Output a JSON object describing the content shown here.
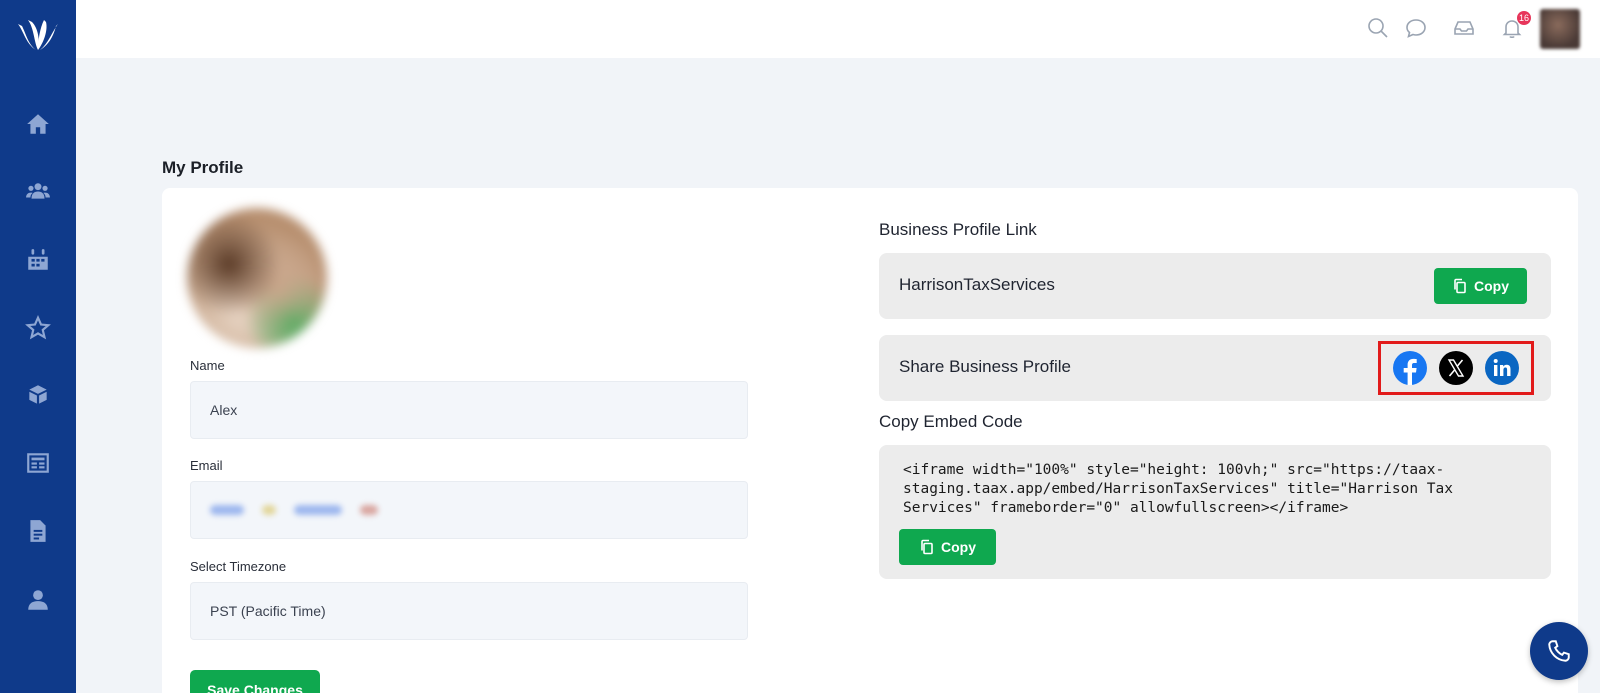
{
  "sidebar": {
    "items": [
      {
        "icon": "home-icon"
      },
      {
        "icon": "users-icon"
      },
      {
        "icon": "calendar-icon"
      },
      {
        "icon": "star-icon"
      },
      {
        "icon": "cube-icon"
      },
      {
        "icon": "newspaper-icon"
      },
      {
        "icon": "document-icon"
      },
      {
        "icon": "user-icon"
      }
    ]
  },
  "topbar": {
    "notification_count": "16"
  },
  "page": {
    "title": "My Profile"
  },
  "profile": {
    "name_label": "Name",
    "name_value": "Alex",
    "email_label": "Email",
    "timezone_label": "Select Timezone",
    "timezone_value": "PST (Pacific Time)",
    "save_label": "Save Changes"
  },
  "business": {
    "link_label": "Business Profile Link",
    "link_value": "HarrisonTaxServices",
    "copy_label": "Copy",
    "share_label": "Share Business Profile",
    "embed_label": "Copy Embed Code",
    "embed_code": "<iframe width=\"100%\" style=\"height: 100vh;\" src=\"https://taax-staging.taax.app/embed/HarrisonTaxServices\" title=\"Harrison Tax Services\" frameborder=\"0\" allowfullscreen></iframe>",
    "embed_copy_label": "Copy"
  },
  "colors": {
    "sidebar": "#0f3a8a",
    "accent_green": "#0fa84f",
    "highlight_red": "#e21b1b",
    "facebook": "#1877f2",
    "linkedin": "#0a66c2"
  }
}
